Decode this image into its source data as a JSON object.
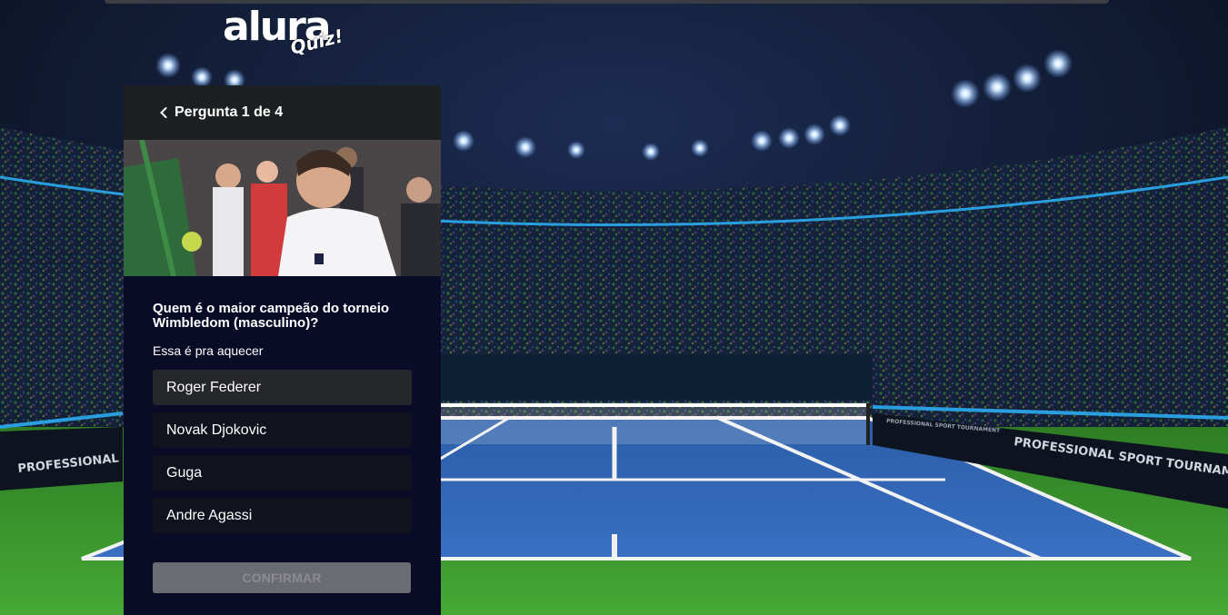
{
  "app": {
    "logo_main": "alura",
    "logo_sub": "Quiz!"
  },
  "quiz": {
    "header_title": "Pergunta 1 de 4",
    "question_title": "Quem é o maior campeão do torneio Wimbledom (masculino)?",
    "question_description": "Essa é pra aquecer",
    "options": [
      {
        "label": "Roger Federer"
      },
      {
        "label": "Novak Djokovic"
      },
      {
        "label": "Guga"
      },
      {
        "label": "Andre Agassi"
      }
    ],
    "confirm_label": "CONFIRMAR"
  },
  "background": {
    "banner_left": "PROFESSIONAL",
    "banner_right": "PROFESSIONAL SPORT TOURNAMENT",
    "sign_center": "PROFESSIONAL SPORT TOURNAMENT"
  },
  "colors": {
    "card_bg": "#0a0c27",
    "header_bg": "#1d2022",
    "option_bg": "#10131d",
    "option_active_bg": "#25272a",
    "button_disabled_bg": "#6b6c72",
    "court_blue": "#2f63b4",
    "grass_green": "#3b9a2c"
  },
  "icons": {
    "back": "chevron-left-icon"
  }
}
